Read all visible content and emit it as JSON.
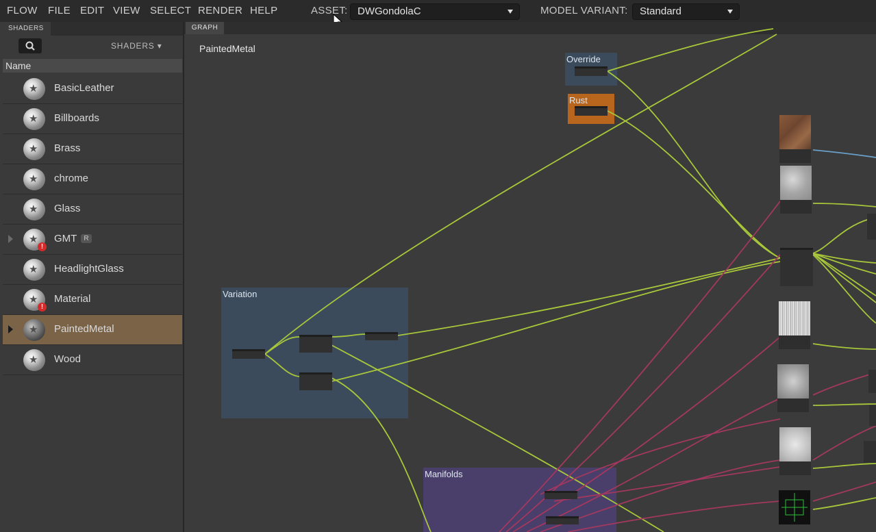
{
  "menu": [
    "FLOW",
    "FILE",
    "EDIT",
    "VIEW",
    "SELECT",
    "RENDER",
    "HELP"
  ],
  "asset": {
    "label": "ASSET:",
    "value": "DWGondolaC"
  },
  "model_variant": {
    "label": "MODEL VARIANT:",
    "value": "Standard"
  },
  "sidebar": {
    "tabs": [
      "SHADERS"
    ],
    "search_icon": "search-icon",
    "filter_label": "SHADERS ▾",
    "column_header": "Name",
    "items": [
      {
        "label": "BasicLeather",
        "warning": false,
        "expandable": false,
        "selected": false
      },
      {
        "label": "Billboards",
        "warning": false,
        "expandable": false,
        "selected": false
      },
      {
        "label": "Brass",
        "warning": false,
        "expandable": false,
        "selected": false
      },
      {
        "label": "chrome",
        "warning": false,
        "expandable": false,
        "selected": false
      },
      {
        "label": "Glass",
        "warning": false,
        "expandable": false,
        "selected": false
      },
      {
        "label": "GMT",
        "badge": "R",
        "warning": true,
        "expandable": true,
        "selected": false
      },
      {
        "label": "HeadlightGlass",
        "warning": false,
        "expandable": false,
        "selected": false
      },
      {
        "label": "Material",
        "warning": true,
        "expandable": false,
        "selected": false
      },
      {
        "label": "PaintedMetal",
        "warning": false,
        "expandable": true,
        "selected": true
      },
      {
        "label": "Wood",
        "warning": false,
        "expandable": false,
        "selected": false
      }
    ]
  },
  "graph": {
    "tab": "GRAPH",
    "title": "PaintedMetal",
    "groups": {
      "override": "Override",
      "rust": "Rust",
      "variation": "Variation",
      "manifolds": "Manifolds"
    }
  },
  "colors": {
    "wire_green": "#a8c83a",
    "wire_pink": "#a3385f",
    "wire_blue": "#6aa0c8",
    "variation_group": "#3c4b5c",
    "manifolds_group": "#4a3f6a",
    "rust_group": "#b8651e",
    "override_group": "#3b4b5c",
    "selection": "#7a6347"
  }
}
